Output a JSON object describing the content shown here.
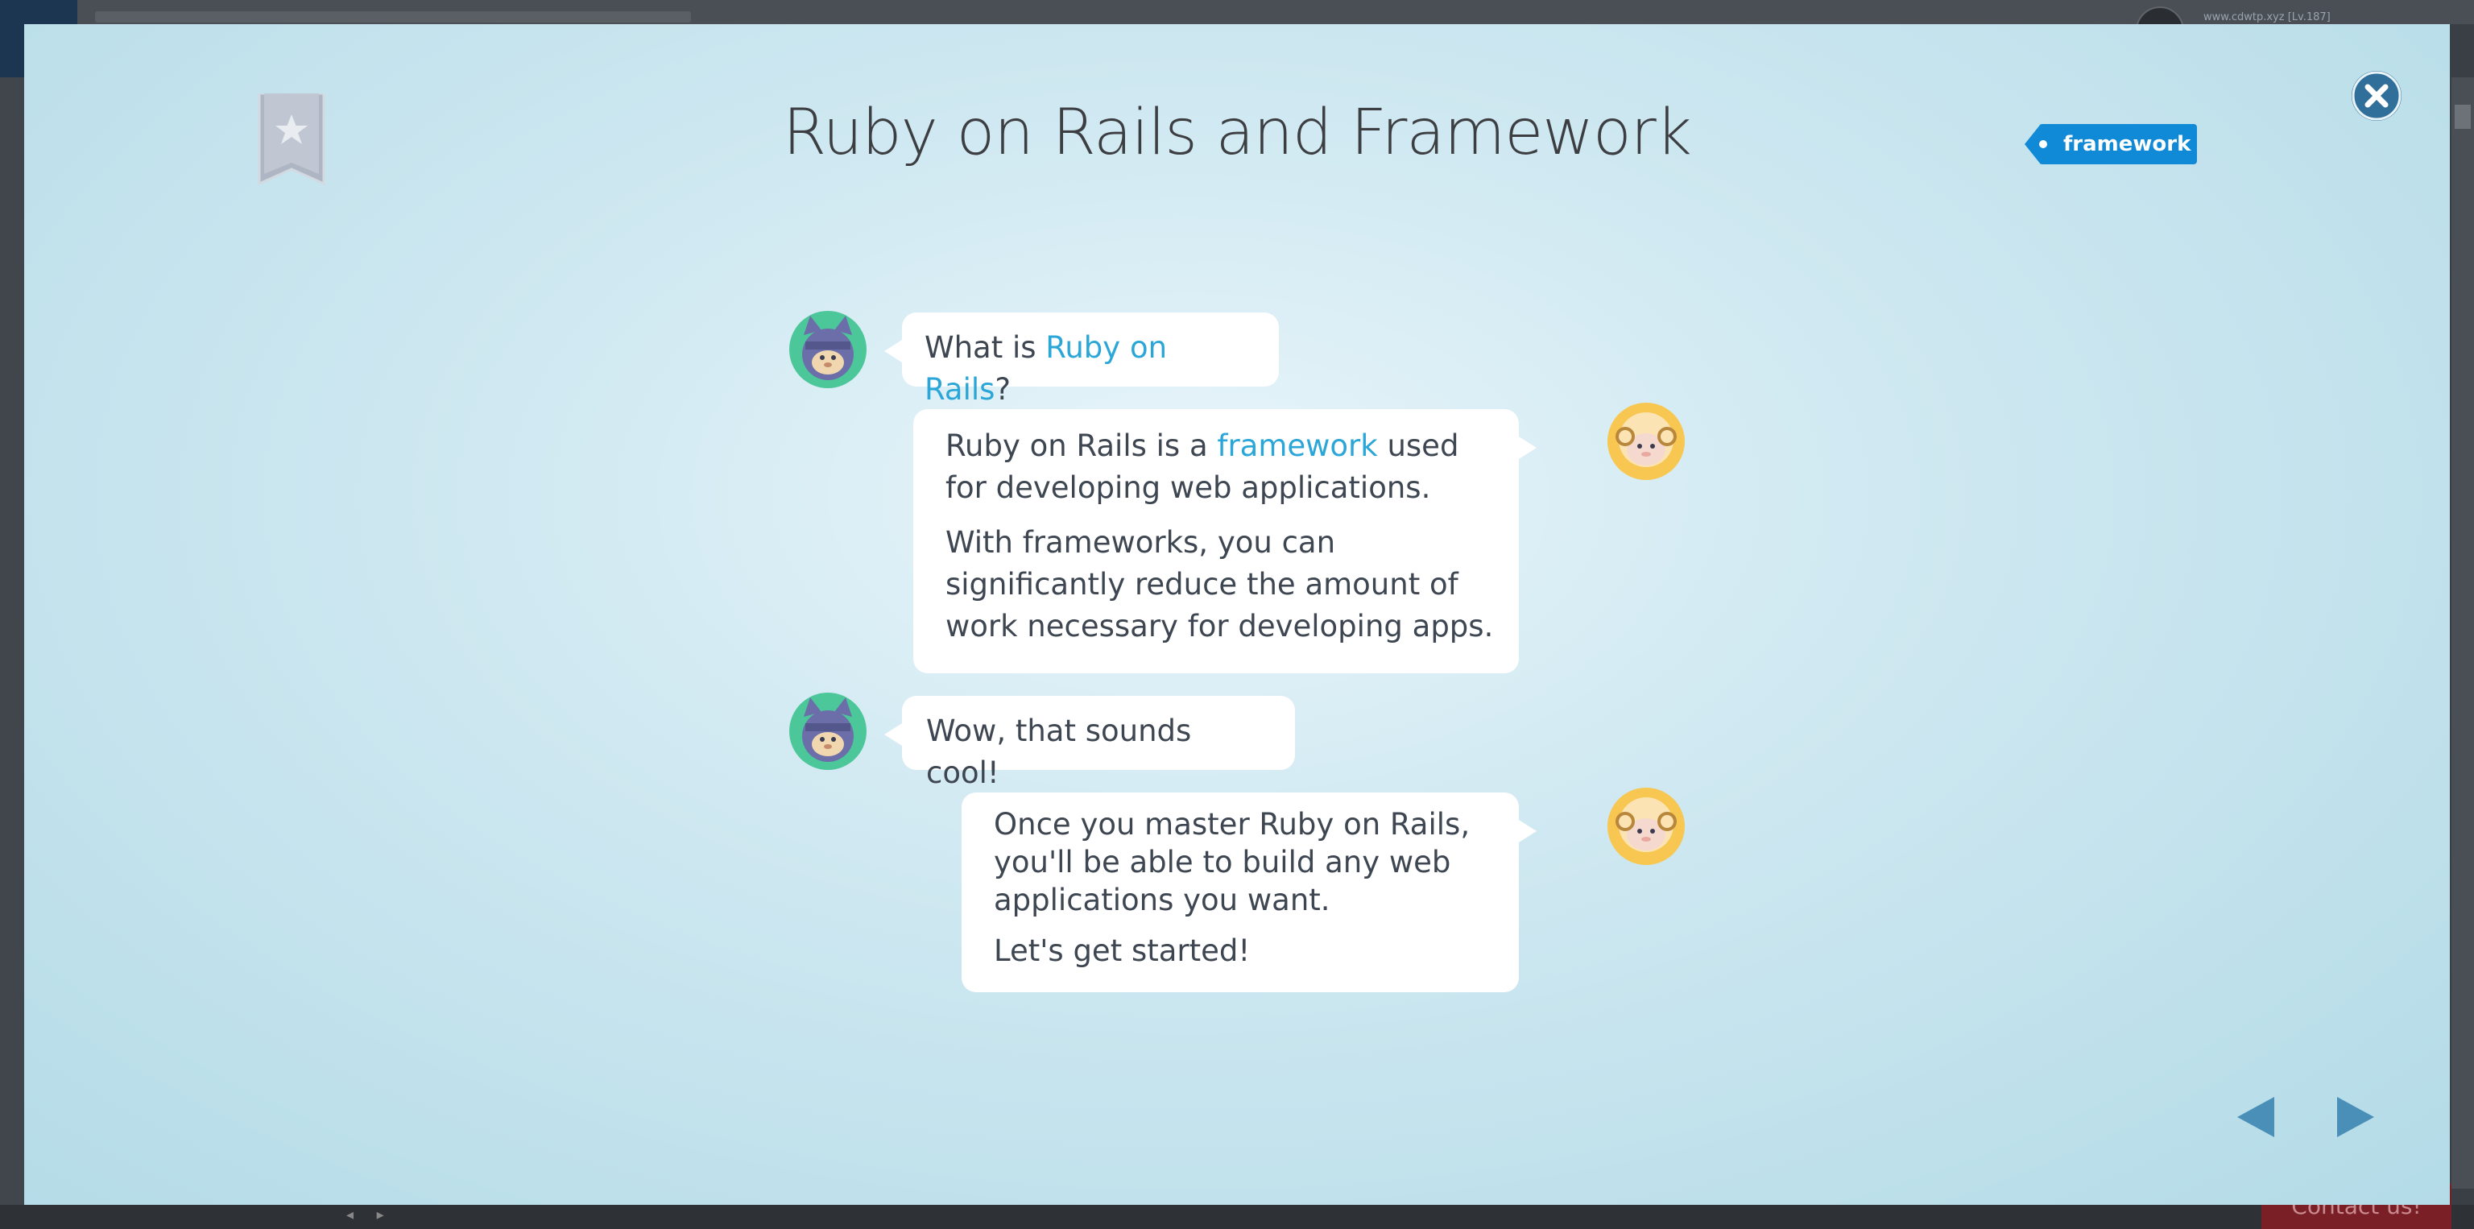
{
  "background": {
    "url_text": "www.cdwtp.xyz [Lv.187]",
    "contact_label": "Contact us!"
  },
  "slide": {
    "title": "Ruby on Rails and Framework",
    "tag_label": "framework",
    "messages": [
      {
        "speaker": "ninja-cat",
        "side": "left",
        "segments": [
          {
            "text": "What is ",
            "highlight": false
          },
          {
            "text": "Ruby on Rails",
            "highlight": true
          },
          {
            "text": "?",
            "highlight": false
          }
        ]
      },
      {
        "speaker": "sheep",
        "side": "right",
        "p1_before": "Ruby on Rails is a ",
        "p1_link": "framework",
        "p1_after": " used for developing web applications.",
        "p2": "With frameworks, you can significantly reduce the amount of work necessary for developing apps."
      },
      {
        "speaker": "ninja-cat",
        "side": "left",
        "text": "Wow, that sounds cool!"
      },
      {
        "speaker": "sheep",
        "side": "right",
        "p1": "Once you master Ruby on Rails, you'll be able to build any web applications you want.",
        "p2": "Let's get started!"
      }
    ]
  },
  "icons": {
    "bookmark": "bookmark-star-icon",
    "close": "close-icon",
    "prev": "previous-arrow-icon",
    "next": "next-arrow-icon",
    "cat_avatar": "ninja-cat-avatar-icon",
    "sheep_avatar": "sheep-avatar-icon"
  },
  "colors": {
    "accent_blue": "#1089d6",
    "highlight_text": "#2aa6d8",
    "close_button": "#2f6f9a",
    "nav_arrow": "#4a8fb8"
  }
}
